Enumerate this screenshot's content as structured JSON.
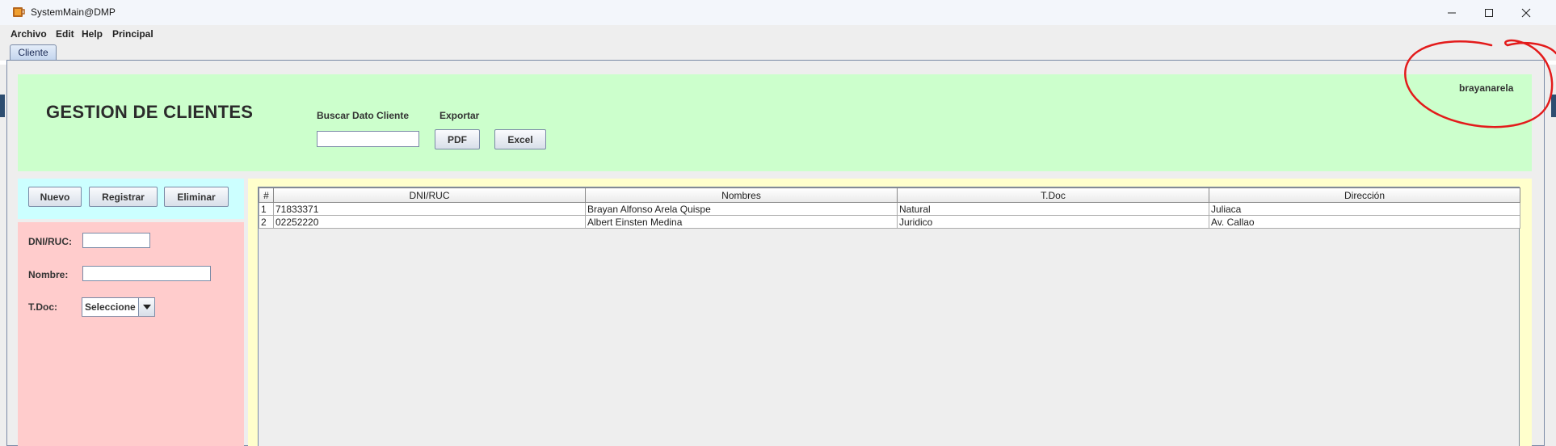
{
  "window": {
    "title": "SystemMain@DMP",
    "app_icon": "java-cup-icon",
    "controls": [
      "minimize-icon",
      "maximize-icon",
      "close-icon"
    ]
  },
  "menu": {
    "items": [
      "Archivo",
      "Edit",
      "Help",
      "Principal"
    ]
  },
  "tabs": [
    {
      "label": "Cliente",
      "selected": true
    }
  ],
  "header": {
    "title": "GESTION DE CLIENTES",
    "search_label": "Buscar Dato Cliente",
    "search_value": "",
    "export_label": "Exportar",
    "pdf_button": "PDF",
    "excel_button": "Excel",
    "username": "brayanarela",
    "background": "#ccffcc"
  },
  "actions": {
    "nuevo": "Nuevo",
    "registrar": "Registrar",
    "eliminar": "Eliminar",
    "background": "#ccffff"
  },
  "form": {
    "dni_label": "DNI/RUC:",
    "dni_value": "",
    "nombre_label": "Nombre:",
    "nombre_value": "",
    "tdoc_label": "T.Doc:",
    "tdoc_selected": "Seleccione",
    "background": "#ffcccc"
  },
  "table": {
    "columns": [
      "#",
      "DNI/RUC",
      "Nombres",
      "T.Doc",
      "Dirección"
    ],
    "rows": [
      [
        "1",
        "71833371",
        "Brayan Alfonso Arela Quispe",
        "Natural",
        "Juliaca"
      ],
      [
        "2",
        "02252220",
        "Albert Einsten Medina",
        "Juridico",
        "Av. Callao"
      ]
    ],
    "background": "#ffffcc"
  },
  "annotation": {
    "color": "#e31b1b"
  }
}
